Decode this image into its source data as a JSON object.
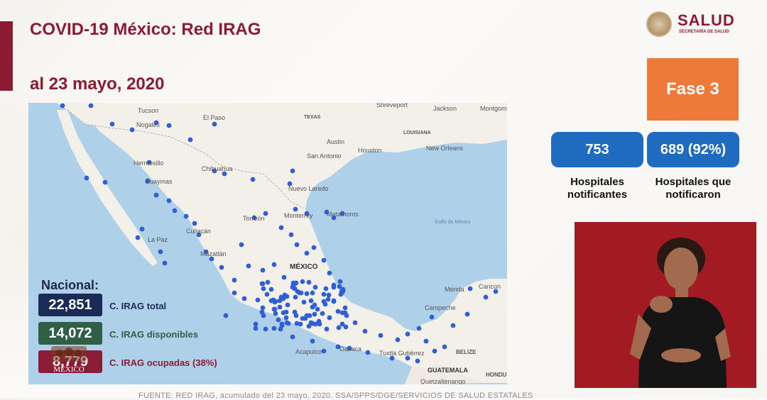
{
  "slide": {
    "title": "COVID-19 México: Red IRAG",
    "date": "al 23 mayo, 2020",
    "footer": "FUENTE: RED IRAG, acumulado del 23 mayo, 2020. SSA/SPPS/DGE/SERVICIOS DE SALUD ESTATALES"
  },
  "logo": {
    "name": "SALUD",
    "subtitle": "SECRETARÍA DE SALUD"
  },
  "phase": {
    "label": "Fase 3",
    "color": "#ee7a3a"
  },
  "stats": [
    {
      "value": "753",
      "label": "Hospitales notificantes"
    },
    {
      "value": "689 (92%)",
      "label": "Hospitales que notificaron"
    }
  ],
  "legend": {
    "heading": "Nacional:",
    "items": [
      {
        "value": "22,851",
        "label": "C. IRAG total",
        "color": "#1a2b57"
      },
      {
        "value": "14,072",
        "label": "C. IRAG disponibles",
        "color": "#2f5f46"
      },
      {
        "value": "8,779",
        "label": "C. IRAG ocupadas (38%)",
        "color": "#8b1c35"
      }
    ],
    "stamp_text": "MÉXICO"
  },
  "map": {
    "water_color": "#aed0e9",
    "land_color": "#f3efe9",
    "dot_color": "#2f5fd6",
    "labels": [
      "Tucson",
      "El Paso",
      "Nogales",
      "Hermosillo",
      "Chihuahua",
      "Guaymas",
      "Culiacán",
      "La Paz",
      "Mazatlán",
      "Torreón",
      "Monterrey",
      "Nuevo Laredo",
      "Matamoros",
      "San Antonio",
      "Austin",
      "Houston",
      "TEXAS",
      "LOUISIANA",
      "Shreveport",
      "Jackson",
      "Montgomery",
      "New Orleans",
      "MÉXICO",
      "Mérida",
      "Cancún",
      "Campeche",
      "Tuxtla Gutiérrez",
      "Oaxaca",
      "Acapulco",
      "BELIZE",
      "GUATEMALA",
      "Quetzaltenango",
      "HONDURAS",
      "Golfo de México"
    ]
  },
  "interpreter": {
    "background": "#a31b22"
  }
}
